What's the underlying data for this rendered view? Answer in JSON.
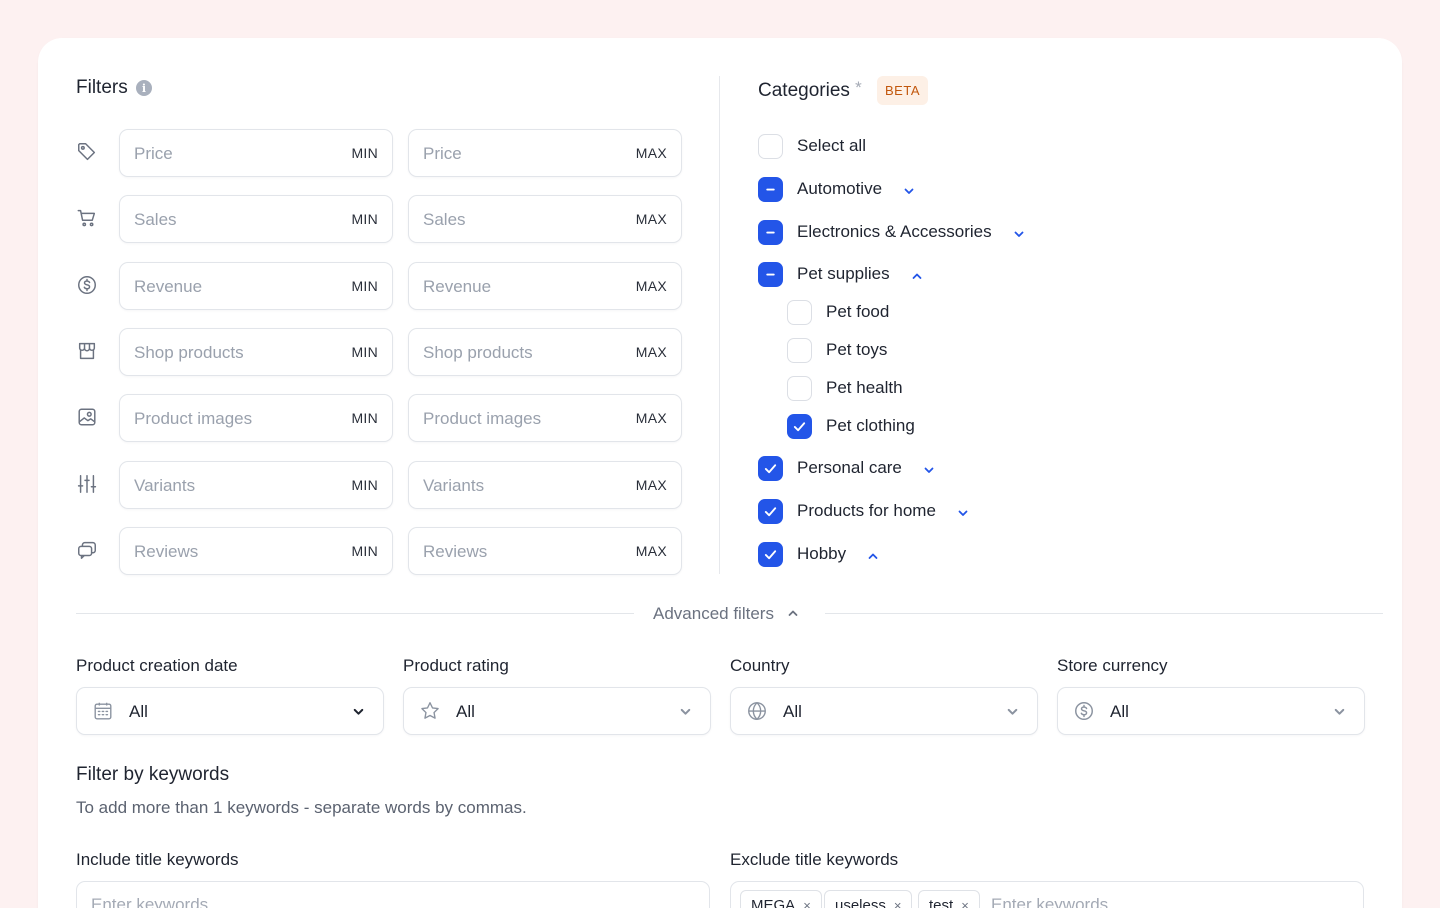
{
  "filters": {
    "title": "Filters",
    "info_icon": "i",
    "rows": [
      {
        "icon": "tag-icon",
        "min_placeholder": "Price",
        "max_placeholder": "Price",
        "min_tag": "MIN",
        "max_tag": "MAX"
      },
      {
        "icon": "cart-icon",
        "min_placeholder": "Sales",
        "max_placeholder": "Sales",
        "min_tag": "MIN",
        "max_tag": "MAX"
      },
      {
        "icon": "dollar-circle-icon",
        "min_placeholder": "Revenue",
        "max_placeholder": "Revenue",
        "min_tag": "MIN",
        "max_tag": "MAX"
      },
      {
        "icon": "store-icon",
        "min_placeholder": "Shop products",
        "max_placeholder": "Shop products",
        "min_tag": "MIN",
        "max_tag": "MAX"
      },
      {
        "icon": "image-icon",
        "min_placeholder": "Product images",
        "max_placeholder": "Product images",
        "min_tag": "MIN",
        "max_tag": "MAX"
      },
      {
        "icon": "sliders-icon",
        "min_placeholder": "Variants",
        "max_placeholder": "Variants",
        "min_tag": "MIN",
        "max_tag": "MAX"
      },
      {
        "icon": "chat-icon",
        "min_placeholder": "Reviews",
        "max_placeholder": "Reviews",
        "min_tag": "MIN",
        "max_tag": "MAX"
      }
    ]
  },
  "categories": {
    "title": "Categories",
    "required_mark": "*",
    "badge": "BETA",
    "items": [
      {
        "label": "Select all",
        "state": "unchecked",
        "expand": "none"
      },
      {
        "label": "Automotive",
        "state": "indeterminate",
        "expand": "collapsed"
      },
      {
        "label": "Electronics & Accessories",
        "state": "indeterminate",
        "expand": "collapsed"
      },
      {
        "label": "Pet supplies",
        "state": "indeterminate",
        "expand": "expanded"
      },
      {
        "label": "Pet food",
        "state": "unchecked",
        "expand": "none",
        "child": true
      },
      {
        "label": "Pet toys",
        "state": "unchecked",
        "expand": "none",
        "child": true
      },
      {
        "label": "Pet health",
        "state": "unchecked",
        "expand": "none",
        "child": true
      },
      {
        "label": "Pet clothing",
        "state": "checked",
        "expand": "none",
        "child": true
      },
      {
        "label": "Personal care",
        "state": "checked",
        "expand": "collapsed"
      },
      {
        "label": "Products for home",
        "state": "checked",
        "expand": "collapsed"
      },
      {
        "label": "Hobby",
        "state": "checked",
        "expand": "expanded"
      }
    ]
  },
  "advanced": {
    "label": "Advanced filters",
    "selects": [
      {
        "label": "Product creation date",
        "value": "All",
        "icon": "calendar-icon",
        "chevron_color": "dark"
      },
      {
        "label": "Product rating",
        "value": "All",
        "icon": "star-icon",
        "chevron_color": "muted"
      },
      {
        "label": "Country",
        "value": "All",
        "icon": "globe-icon",
        "chevron_color": "muted"
      },
      {
        "label": "Store currency",
        "value": "All",
        "icon": "dollar-circle-icon",
        "chevron_color": "muted"
      }
    ]
  },
  "keywords": {
    "title": "Filter by keywords",
    "hint": "To add more than 1 keywords - separate words by commas.",
    "include_label": "Include title keywords",
    "include_placeholder": "Enter keywords",
    "exclude_label": "Exclude title keywords",
    "exclude_chips": [
      "MEGA",
      "useless",
      "test"
    ],
    "exclude_placeholder": "Enter keywords",
    "chip_remove": "×"
  },
  "colors": {
    "accent": "#2355e8",
    "badge_bg": "#fdf0e6",
    "badge_text": "#c2570c",
    "page_bg": "#fdf1f1"
  }
}
